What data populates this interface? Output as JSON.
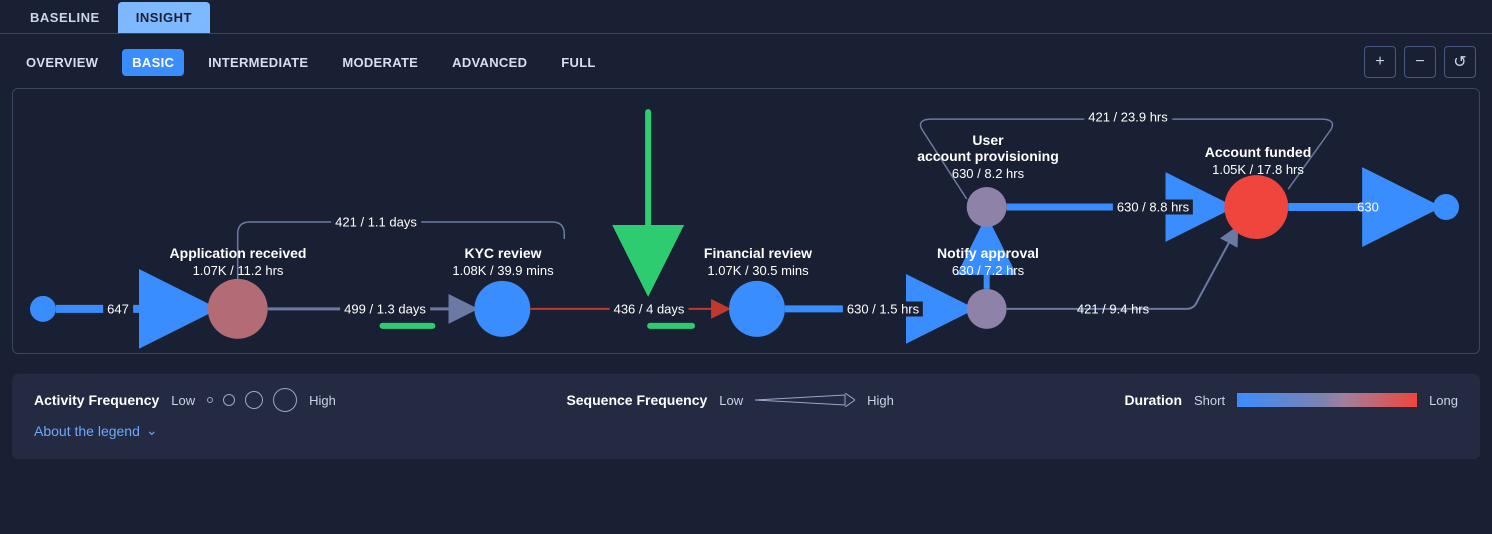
{
  "top_tabs": {
    "baseline": "BASELINE",
    "insight": "INSIGHT"
  },
  "sub_tabs": {
    "overview": "OVERVIEW",
    "basic": "BASIC",
    "intermediate": "INTERMEDIATE",
    "moderate": "MODERATE",
    "advanced": "ADVANCED",
    "full": "FULL"
  },
  "controls": {
    "zoom_in": "plus-icon",
    "zoom_out": "minus-icon",
    "reset": "reset-icon"
  },
  "nodes": {
    "start": {
      "label": "",
      "stat": ""
    },
    "app_received": {
      "label": "Application received",
      "stat": "1.07K / 11.2 hrs"
    },
    "kyc": {
      "label": "KYC review",
      "stat": "1.08K / 39.9 mins"
    },
    "fin": {
      "label": "Financial review",
      "stat": "1.07K / 30.5 mins"
    },
    "notify": {
      "label": "Notify approval",
      "stat": "630 / 7.2 hrs"
    },
    "provision_l1": "User",
    "provision_l2": "account provisioning",
    "provision_stat": "630 / 8.2 hrs",
    "funded": {
      "label": "Account funded",
      "stat": "1.05K / 17.8 hrs"
    },
    "end": {
      "label": "",
      "stat": ""
    }
  },
  "edges": {
    "start_app": "647",
    "app_kyc": "499 / 1.3 days",
    "kyc_fin": "436 / 4 days",
    "fin_notify": "630 / 1.5 hrs",
    "notify_funded": "421 / 9.4 hrs",
    "funded_end": "630",
    "app_kyc_top": "421 / 1.1 days",
    "notify_prov": "",
    "prov_funded": "630 / 8.8 hrs",
    "notify_funded_top": "421 / 23.9 hrs"
  },
  "legend": {
    "activity_freq": "Activity Frequency",
    "sequence_freq": "Sequence Frequency",
    "duration": "Duration",
    "low": "Low",
    "high": "High",
    "short": "Short",
    "long": "Long",
    "about": "About the legend"
  },
  "colors": {
    "blue": "#3a8dff",
    "mauve": "#b36b76",
    "purple": "#8f82a8",
    "red": "#f0453c",
    "edge_thin": "#6b7aa3",
    "edge_red": "#c0392b",
    "green": "#2ecc71"
  }
}
